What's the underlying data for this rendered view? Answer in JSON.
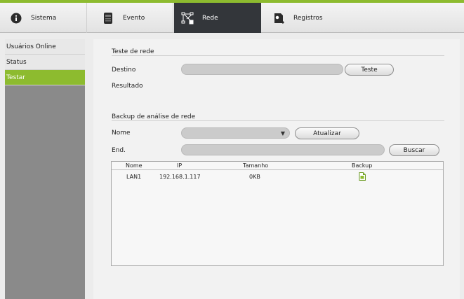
{
  "tabs": [
    {
      "label": "Sistema",
      "icon": "info-icon",
      "active": false
    },
    {
      "label": "Evento",
      "icon": "camera-icon",
      "active": false
    },
    {
      "label": "Rede",
      "icon": "network-icon",
      "active": true
    },
    {
      "label": "Registros",
      "icon": "log-icon",
      "active": false
    }
  ],
  "sidebar": {
    "items": [
      {
        "label": "Usuários Online",
        "active": false
      },
      {
        "label": "Status",
        "active": false
      },
      {
        "label": "Testar",
        "active": true
      }
    ]
  },
  "test": {
    "section_title": "Teste de rede",
    "destino_label": "Destino",
    "destino_value": "",
    "test_button": "Teste",
    "resultado_label": "Resultado",
    "resultado_value": ""
  },
  "backup": {
    "section_title": "Backup de análise de rede",
    "nome_label": "Nome",
    "nome_selected": "",
    "atualizar_button": "Atualizar",
    "end_label": "End.",
    "end_value": "",
    "buscar_button": "Buscar",
    "table": {
      "headers": [
        "Nome",
        "IP",
        "Tamanho",
        "Backup"
      ],
      "rows": [
        {
          "nome": "LAN1",
          "ip": "192.168.1.117",
          "tamanho": "0KB",
          "backup_icon": "file-icon"
        }
      ]
    }
  },
  "colors": {
    "accent": "#8dbb2f",
    "active_tab": "#33363a",
    "sidebar_bg": "#8a8a8a"
  }
}
